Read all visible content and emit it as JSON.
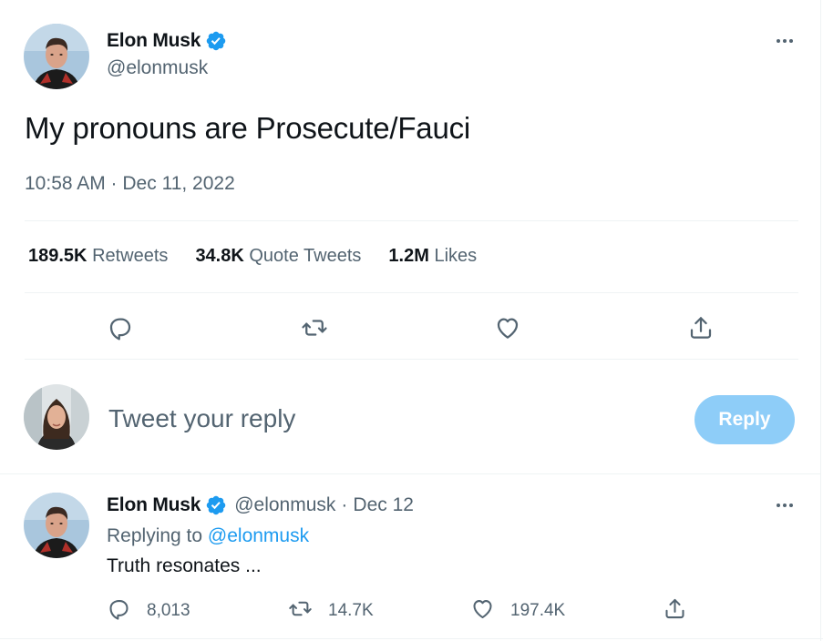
{
  "main_tweet": {
    "author_name": "Elon Musk",
    "author_handle": "@elonmusk",
    "text": "My pronouns are Prosecute/Fauci",
    "timestamp": "10:58 AM · Dec 11, 2022",
    "stats": [
      {
        "value": "189.5K",
        "label": "Retweets"
      },
      {
        "value": "34.8K",
        "label": "Quote Tweets"
      },
      {
        "value": "1.2M",
        "label": "Likes"
      }
    ],
    "actions": [
      "reply-icon",
      "retweet-icon",
      "like-icon",
      "share-icon"
    ]
  },
  "composer": {
    "placeholder": "Tweet your reply",
    "button_label": "Reply"
  },
  "reply_tweet": {
    "author_name": "Elon Musk",
    "author_handle": "@elonmusk",
    "separator": "·",
    "date": "Dec 12",
    "replying_prefix": "Replying to",
    "replying_to": "@elonmusk",
    "text": "Truth resonates ...",
    "counts": {
      "replies": "8,013",
      "retweets": "14.7K",
      "likes": "197.4K"
    }
  },
  "colors": {
    "accent": "#1d9bf0",
    "reply_button": "#8ecdf8",
    "secondary_text": "#536471",
    "divider": "#eff3f4"
  }
}
